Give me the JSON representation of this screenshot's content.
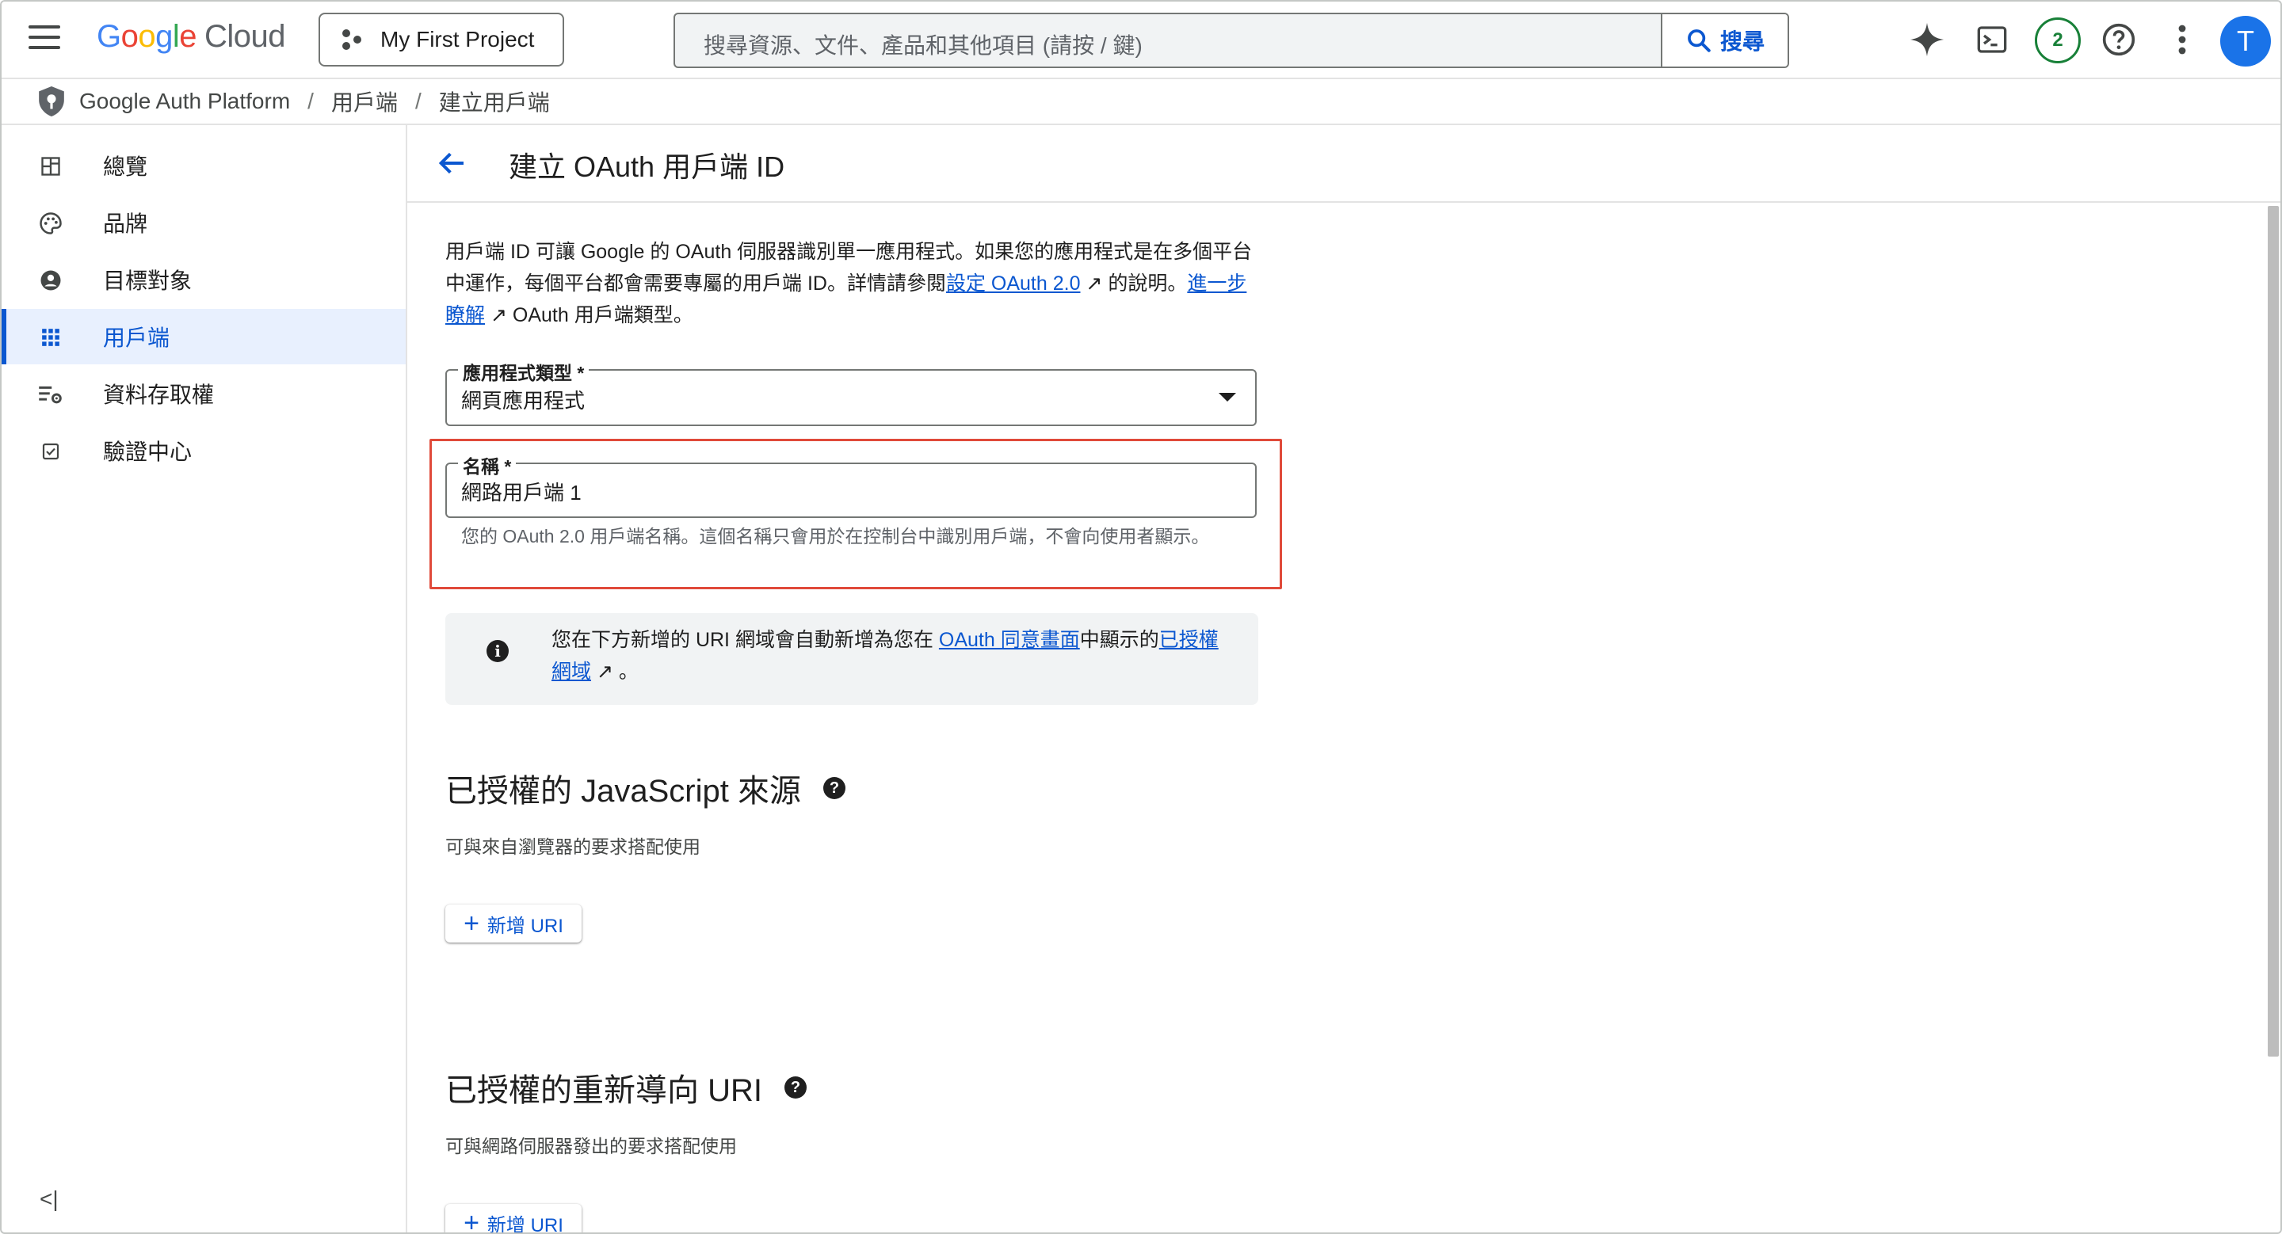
{
  "topbar": {
    "logo_google": "Google",
    "logo_cloud": "Cloud",
    "project": "My First Project",
    "search_placeholder": "搜尋資源、文件、產品和其他項目 (請按 / 鍵)",
    "search_button": "搜尋",
    "notification_count": "2",
    "avatar_letter": "T"
  },
  "breadcrumb": {
    "items": [
      "Google Auth Platform",
      "用戶端",
      "建立用戶端"
    ],
    "separator": "/"
  },
  "sidebar": {
    "items": [
      {
        "label": "總覽",
        "icon": "dashboard-icon"
      },
      {
        "label": "品牌",
        "icon": "palette-icon"
      },
      {
        "label": "目標對象",
        "icon": "person-icon"
      },
      {
        "label": "用戶端",
        "icon": "apps-grid-icon",
        "active": true
      },
      {
        "label": "資料存取權",
        "icon": "data-settings-icon"
      },
      {
        "label": "驗證中心",
        "icon": "check-box-icon"
      }
    ],
    "collapse_label": "<|"
  },
  "page": {
    "title": "建立 OAuth 用戶端 ID",
    "intro_1": "用戶端 ID 可讓 Google 的 OAuth 伺服器識別單一應用程式。如果您的應用程式是在多個平台中運作，每個平台都會需要專屬的用戶端 ID。詳情請參閱",
    "intro_link_1": "設定 OAuth 2.0",
    "intro_2": " 的說明。",
    "intro_link_2": "進一步瞭解",
    "intro_3": " OAuth 用戶端類型。"
  },
  "form": {
    "app_type_label": "應用程式類型 *",
    "app_type_value": "網頁應用程式",
    "name_label": "名稱 *",
    "name_value": "網路用戶端 1",
    "name_hint": "您的 OAuth 2.0 用戶端名稱。這個名稱只會用於在控制台中識別用戶端，不會向使用者顯示。"
  },
  "info": {
    "text_1": "您在下方新增的 URI 網域會自動新增為您在 ",
    "link_1": "OAuth 同意畫面",
    "text_2": "中顯示的",
    "link_2": "已授權網域",
    "text_3": " 。"
  },
  "js_origins": {
    "title": "已授權的 JavaScript 來源",
    "subtitle": "可與來自瀏覽器的要求搭配使用",
    "add_label": "新增 URI"
  },
  "redirect_uris": {
    "title": "已授權的重新導向 URI",
    "subtitle": "可與網路伺服器發出的要求搭配使用",
    "add_label": "新增 URI"
  },
  "colors": {
    "accent": "#0b57d0",
    "highlight_box": "#e04a3a",
    "active_nav_bg": "#e8f0fe",
    "badge": "#188038",
    "avatar": "#1a73e8"
  }
}
